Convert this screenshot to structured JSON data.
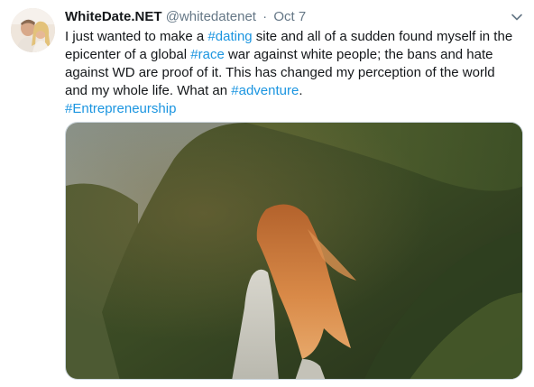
{
  "tweet": {
    "display_name": "WhiteDate.NET",
    "handle": "@whitedatenet",
    "separator": "·",
    "date": "Oct 7",
    "body": {
      "line1": {
        "t1": "I just wanted to make a ",
        "tag1": "#dating",
        "t2": " site and all of a sudden found myself in the"
      },
      "line2": {
        "t1": "epicenter of a global ",
        "tag1": "#race",
        "t2": " war against white people; the bans and hate"
      },
      "line3": {
        "t1": "against WD are proof of it.  This has changed my perception of the world"
      },
      "line4": {
        "t1": "and my whole life. What an ",
        "tag1": "#adventure",
        "t2": "."
      },
      "line5": {
        "tag1": "#Entrepreneurship"
      }
    }
  },
  "colors": {
    "link": "#1b95e0",
    "text": "#14171a",
    "muted": "#657786"
  },
  "icons": {
    "menu": "chevron-down-icon"
  }
}
